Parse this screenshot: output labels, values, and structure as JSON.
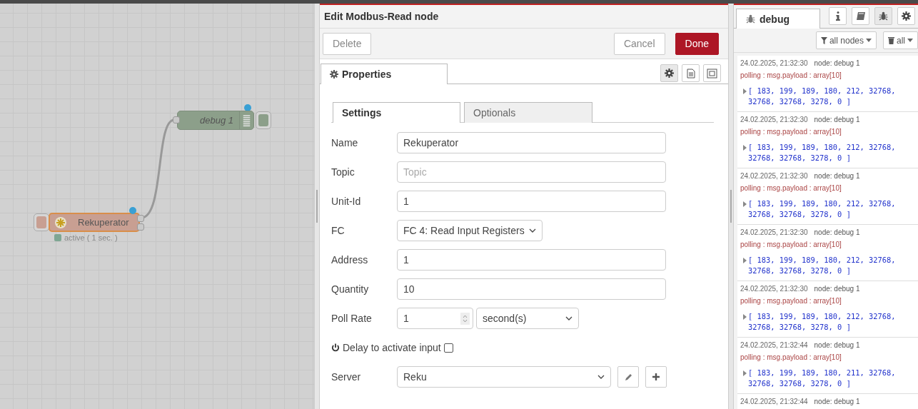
{
  "canvas": {
    "nodes": [
      {
        "kind": "debug",
        "label": "debug 1",
        "changed": true
      },
      {
        "kind": "modbus",
        "label": "Rekuperator",
        "changed": true,
        "status": {
          "text": "active ( 1 sec. )",
          "color": "#7fa693"
        }
      }
    ]
  },
  "editor": {
    "title": "Edit Modbus-Read node",
    "buttons": [
      {
        "label": "Delete",
        "kind": "plain"
      },
      {
        "label": "Cancel",
        "kind": "plain"
      },
      {
        "label": "Done",
        "kind": "primary"
      }
    ],
    "tabs": [
      {
        "label": "Properties",
        "selected": true
      }
    ],
    "tab_icons": [
      {
        "kind": "gear",
        "selected": true
      },
      {
        "kind": "document",
        "selected": false
      },
      {
        "kind": "frame",
        "selected": false
      }
    ],
    "subtabs": [
      {
        "label": "Settings",
        "selected": true
      },
      {
        "label": "Optionals",
        "selected": false
      }
    ],
    "fields": [
      {
        "kind": "text",
        "label": "Name",
        "value": "Rekuperator"
      },
      {
        "kind": "text",
        "label": "Topic",
        "placeholder": "Topic"
      },
      {
        "kind": "text",
        "label": "Unit-Id",
        "value": "1"
      },
      {
        "kind": "select",
        "label": "FC",
        "value": "FC 4: Read Input Registers"
      },
      {
        "kind": "text",
        "label": "Address",
        "value": "1"
      },
      {
        "kind": "text",
        "label": "Quantity",
        "value": "10"
      },
      {
        "kind": "rate",
        "label": "Poll Rate",
        "value": "1",
        "unit": "second(s)"
      },
      {
        "kind": "checkbox",
        "label": "Delay to activate input",
        "checked": false
      },
      {
        "kind": "config",
        "label": "Server",
        "value": "Reku"
      }
    ]
  },
  "sidebar": {
    "tabs": [
      {
        "label": "debug",
        "selected": true
      }
    ],
    "tab_icons": [
      {
        "kind": "info",
        "selected": false
      },
      {
        "kind": "book",
        "selected": false
      },
      {
        "kind": "bug",
        "selected": true
      },
      {
        "kind": "gear",
        "selected": false
      }
    ],
    "filter": "all nodes",
    "clear": "all",
    "messages": [
      {
        "time": "24.02.2025, 21:32:30",
        "node": "node: debug 1",
        "topic": "polling : msg.payload : array[10]",
        "value": "[ 183, 199, 189, 180, 212, 32768, 32768, 32768, 3278, 0 ]"
      },
      {
        "time": "24.02.2025, 21:32:30",
        "node": "node: debug 1",
        "topic": "polling : msg.payload : array[10]",
        "value": "[ 183, 199, 189, 180, 212, 32768, 32768, 32768, 3278, 0 ]"
      },
      {
        "time": "24.02.2025, 21:32:30",
        "node": "node: debug 1",
        "topic": "polling : msg.payload : array[10]",
        "value": "[ 183, 199, 189, 180, 212, 32768, 32768, 32768, 3278, 0 ]"
      },
      {
        "time": "24.02.2025, 21:32:30",
        "node": "node: debug 1",
        "topic": "polling : msg.payload : array[10]",
        "value": "[ 183, 199, 189, 180, 212, 32768, 32768, 32768, 3278, 0 ]"
      },
      {
        "time": "24.02.2025, 21:32:30",
        "node": "node: debug 1",
        "topic": "polling : msg.payload : array[10]",
        "value": "[ 183, 199, 189, 180, 212, 32768, 32768, 32768, 3278, 0 ]"
      },
      {
        "time": "24.02.2025, 21:32:44",
        "node": "node: debug 1",
        "topic": "polling : msg.payload : array[10]",
        "value": "[ 183, 199, 189, 180, 211, 32768, 32768, 32768, 3278, 0 ]"
      },
      {
        "time": "24.02.2025, 21:32:44",
        "node": "node: debug 1"
      }
    ]
  }
}
